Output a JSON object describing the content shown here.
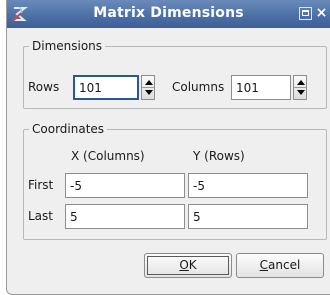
{
  "window": {
    "title": "Matrix Dimensions",
    "icons": [
      "app-icon",
      "maximize-icon",
      "close-icon"
    ]
  },
  "dimensions": {
    "legend": "Dimensions",
    "rows_label": "Rows",
    "rows_value": "101",
    "columns_label": "Columns",
    "columns_value": "101"
  },
  "coordinates": {
    "legend": "Coordinates",
    "x_header": "X (Columns)",
    "y_header": "Y (Rows)",
    "first_label": "First",
    "first_x": "-5",
    "first_y": "-5",
    "last_label": "Last",
    "last_x": "5",
    "last_y": "5"
  },
  "buttons": {
    "ok_mnemonic": "O",
    "ok_rest": "K",
    "cancel_mnemonic": "C",
    "cancel_rest": "ancel"
  },
  "colors": {
    "titlebar": "#4a6ea6",
    "focus": "#2b5797"
  }
}
